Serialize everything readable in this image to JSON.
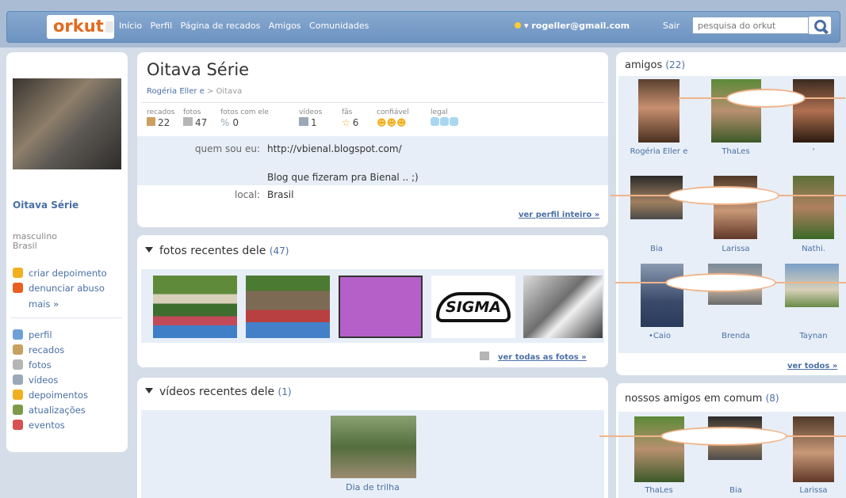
{
  "header": {
    "logo": "orkut",
    "nav": [
      "Início",
      "Perfil",
      "Página de recados",
      "Amigos",
      "Comunidades"
    ],
    "user_email": "rogeller@gmail.com",
    "logout": "Sair",
    "search_placeholder": "pesquisa do orkut"
  },
  "left": {
    "name": "Oitava Série",
    "gender": "masculino",
    "country": "Brasil",
    "actions": [
      "criar depoimento",
      "denunciar abuso",
      "mais »"
    ],
    "menu": [
      {
        "label": "perfil",
        "icon": "person-icon"
      },
      {
        "label": "recados",
        "icon": "scrap-icon"
      },
      {
        "label": "fotos",
        "icon": "photo-icon"
      },
      {
        "label": "vídeos",
        "icon": "video-icon"
      },
      {
        "label": "depoimentos",
        "icon": "testimonial-icon"
      },
      {
        "label": "atualizações",
        "icon": "updates-icon"
      },
      {
        "label": "eventos",
        "icon": "calendar-icon"
      }
    ]
  },
  "main": {
    "title": "Oitava Série",
    "breadcrumb_owner": "Rogéria Eller e",
    "breadcrumb_sep": ">",
    "breadcrumb_current": "Oitava",
    "stats": [
      {
        "label": "recados",
        "value": "22"
      },
      {
        "label": "fotos",
        "value": "47"
      },
      {
        "label": "fotos com ele",
        "value": "0"
      },
      {
        "label": "vídeos",
        "value": "1"
      },
      {
        "label": "fãs",
        "value": "6"
      },
      {
        "label": "confiável",
        "value": ""
      },
      {
        "label": "legal",
        "value": ""
      }
    ],
    "about_label": "quem sou eu:",
    "about_url": "http://vbienal.blogspot.com/",
    "about_text": "Blog que fizeram pra Bienal .. ;)",
    "location_label": "local:",
    "location_value": "Brasil",
    "view_full": "ver perfil inteiro »",
    "photos_title": "fotos recentes dele",
    "photos_count": "(47)",
    "photos_all": "ver todas as fotos »",
    "photos_logo_text": "SIGMA",
    "videos_title": "vídeos recentes dele",
    "videos_count": "(1)",
    "video_caption": "Dia de trilha"
  },
  "friends": {
    "title": "amigos",
    "count": "(22)",
    "names": [
      "Rogéria Eller e",
      "ThaLes",
      "'",
      "Bia",
      "Larissa",
      "Nathi.",
      "•Caio",
      "Brenda",
      "Taynan"
    ],
    "view_all": "ver todos »"
  },
  "common": {
    "title": "nossos amigos em comum",
    "count": "(8)",
    "names": [
      "ThaLes",
      "Bia",
      "Larissa"
    ]
  },
  "colors": {
    "accent": "#4a6fa5",
    "orange": "#e36a1f",
    "band": "#e7eef7"
  }
}
